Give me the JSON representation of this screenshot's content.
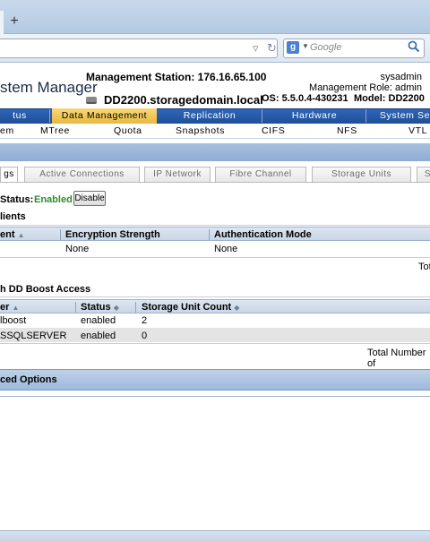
{
  "browser": {
    "new_tab_label": "+",
    "search_placeholder": "Google",
    "search_engine_letter": "g"
  },
  "header": {
    "app_title": "stem Manager",
    "management_station": "Management Station: 176.16.65.100",
    "system_name": "DD2200.storagedomain.local",
    "user": "sysadmin",
    "role": "Management Role: admin",
    "os": "OS: 5.5.0.4-430231",
    "model": "Model: DD2200"
  },
  "main_nav": [
    {
      "label": "tus"
    },
    {
      "label": "Data Management"
    },
    {
      "label": "Replication"
    },
    {
      "label": "Hardware"
    },
    {
      "label": "System Se"
    }
  ],
  "sub_nav": [
    {
      "label": "em"
    },
    {
      "label": "MTree"
    },
    {
      "label": "Quota"
    },
    {
      "label": "Snapshots"
    },
    {
      "label": "CIFS"
    },
    {
      "label": "NFS"
    },
    {
      "label": "VTL"
    }
  ],
  "page_tabs": [
    {
      "label": "gs"
    },
    {
      "label": "Active Connections"
    },
    {
      "label": "IP Network"
    },
    {
      "label": "Fibre Channel"
    },
    {
      "label": "Storage Units"
    },
    {
      "label": "S"
    }
  ],
  "status": {
    "label": "Status:",
    "value": "Enabled",
    "button": "Disable",
    "value_color": "#2e8b2e"
  },
  "clients_section": {
    "title": "lients",
    "columns": [
      "ent",
      "Encryption Strength",
      "Authentication Mode"
    ],
    "rows": [
      [
        "",
        "None",
        "None"
      ]
    ],
    "footer": "Tot"
  },
  "access_section": {
    "title": "h DD Boost Access",
    "columns": [
      "er",
      "Status",
      "Storage Unit Count"
    ],
    "rows": [
      [
        "lboost",
        "enabled",
        "2"
      ],
      [
        "SSQLSERVER",
        "enabled",
        "0"
      ]
    ],
    "footer": "Total Number of"
  },
  "advanced": {
    "label": "ced Options"
  },
  "colors": {
    "nav_blue": "#1e4f99",
    "nav_active": "#e9b93c",
    "enabled_green": "#2e8b2e"
  }
}
